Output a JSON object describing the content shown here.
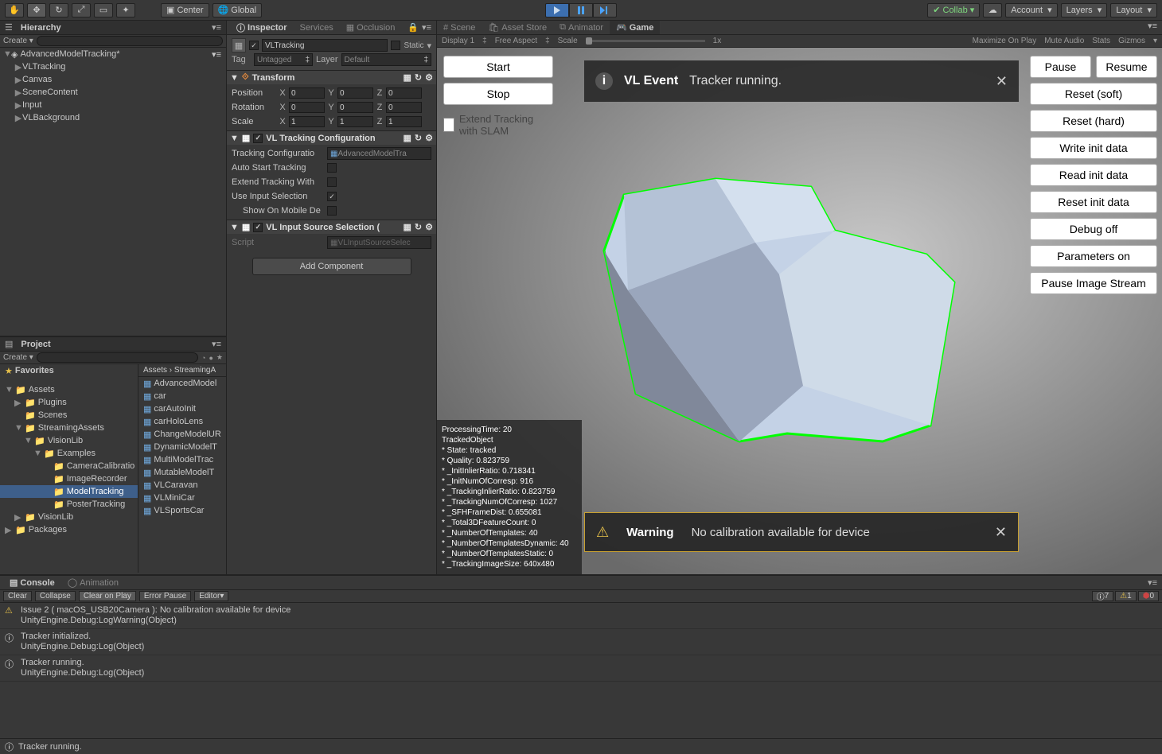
{
  "toolbar": {
    "pivot": "Center",
    "handle": "Global",
    "collab": "Collab",
    "account": "Account",
    "layers": "Layers",
    "layout": "Layout"
  },
  "hierarchy": {
    "title": "Hierarchy",
    "create": "Create",
    "scene": "AdvancedModelTracking*",
    "items": [
      "VLTracking",
      "Canvas",
      "SceneContent",
      "Input",
      "VLBackground"
    ]
  },
  "project": {
    "title": "Project",
    "create": "Create",
    "favorites": "Favorites",
    "tree": [
      {
        "label": "Assets",
        "depth": 0,
        "arrow": "▼"
      },
      {
        "label": "Plugins",
        "depth": 1,
        "arrow": "▶"
      },
      {
        "label": "Scenes",
        "depth": 1,
        "arrow": ""
      },
      {
        "label": "StreamingAssets",
        "depth": 1,
        "arrow": "▼"
      },
      {
        "label": "VisionLib",
        "depth": 2,
        "arrow": "▼"
      },
      {
        "label": "Examples",
        "depth": 3,
        "arrow": "▼"
      },
      {
        "label": "CameraCalibratio",
        "depth": 4,
        "arrow": ""
      },
      {
        "label": "ImageRecorder",
        "depth": 4,
        "arrow": ""
      },
      {
        "label": "ModelTracking",
        "depth": 4,
        "arrow": "",
        "sel": true
      },
      {
        "label": "PosterTracking",
        "depth": 4,
        "arrow": ""
      },
      {
        "label": "VisionLib",
        "depth": 1,
        "arrow": "▶"
      },
      {
        "label": "Packages",
        "depth": 0,
        "arrow": "▶"
      }
    ],
    "breadcrumb": [
      "Assets",
      "StreamingA"
    ],
    "files": [
      "AdvancedModel",
      "car",
      "carAutoInit",
      "carHoloLens",
      "ChangeModelUR",
      "DynamicModelT",
      "MultiModelTrac",
      "MutableModelT",
      "VLCaravan",
      "VLMiniCar",
      "VLSportsCar"
    ]
  },
  "inspector": {
    "title": "Inspector",
    "tabs": [
      "Services",
      "Occlusion"
    ],
    "obj_name": "VLTracking",
    "static": "Static",
    "tag_lbl": "Tag",
    "tag": "Untagged",
    "layer_lbl": "Layer",
    "layer": "Default",
    "transform": {
      "title": "Transform",
      "position": {
        "label": "Position",
        "x": "0",
        "y": "0",
        "z": "0"
      },
      "rotation": {
        "label": "Rotation",
        "x": "0",
        "y": "0",
        "z": "0"
      },
      "scale": {
        "label": "Scale",
        "x": "1",
        "y": "1",
        "z": "1"
      }
    },
    "vltracking": {
      "title": "VL Tracking Configuration",
      "fields": {
        "cfg_lbl": "Tracking Configuratio",
        "cfg_val": "AdvancedModelTra",
        "auto_lbl": "Auto Start Tracking",
        "ext_lbl": "Extend Tracking With",
        "inp_lbl": "Use Input Selection",
        "mob_lbl": "Show On Mobile De"
      }
    },
    "vlinput": {
      "title": "VL Input Source Selection (",
      "script_lbl": "Script",
      "script_val": "VLInputSourceSelec"
    },
    "add_component": "Add Component"
  },
  "game": {
    "tabs": {
      "scene": "Scene",
      "asset_store": "Asset Store",
      "animator": "Animator",
      "game": "Game"
    },
    "opts": {
      "display": "Display 1",
      "aspect": "Free Aspect",
      "scale_lbl": "Scale",
      "scale_val": "1x",
      "max": "Maximize On Play",
      "mute": "Mute Audio",
      "stats": "Stats",
      "gizmos": "Gizmos"
    },
    "left_buttons": {
      "start": "Start",
      "stop": "Stop"
    },
    "extend_label": "Extend Tracking with SLAM",
    "event": {
      "title": "VL Event",
      "msg": "Tracker running."
    },
    "right_buttons": [
      "Pause",
      "Resume",
      "Reset (soft)",
      "Reset (hard)",
      "Write init data",
      "Read init data",
      "Reset init data",
      "Debug off",
      "Parameters on",
      "Pause Image Stream"
    ],
    "stats": [
      "ProcessingTime: 20",
      "TrackedObject",
      "* State: tracked",
      "* Quality: 0.823759",
      "* _InitInlierRatio: 0.718341",
      "* _InitNumOfCorresp: 916",
      "* _TrackingInlierRatio: 0.823759",
      "* _TrackingNumOfCorresp: 1027",
      "* _SFHFrameDist: 0.655081",
      "* _Total3DFeatureCount: 0",
      "* _NumberOfTemplates: 40",
      "* _NumberOfTemplatesDynamic: 40",
      "* _NumberOfTemplatesStatic: 0",
      "* _TrackingImageSize: 640x480"
    ],
    "warning": {
      "title": "Warning",
      "msg": "No calibration available for device"
    }
  },
  "console": {
    "title": "Console",
    "anim": "Animation",
    "bar": {
      "clear": "Clear",
      "collapse": "Collapse",
      "cop": "Clear on Play",
      "ep": "Error Pause",
      "editor": "Editor"
    },
    "counts": {
      "info": "7",
      "warn": "1",
      "err": "0"
    },
    "logs": [
      {
        "icon": "warn",
        "line1": "Issue 2 ( macOS_USB20Camera ): No calibration available for device",
        "line2": "UnityEngine.Debug:LogWarning(Object)"
      },
      {
        "icon": "info",
        "line1": "Tracker initialized.",
        "line2": "UnityEngine.Debug:Log(Object)"
      },
      {
        "icon": "info",
        "line1": "Tracker running.",
        "line2": "UnityEngine.Debug:Log(Object)"
      }
    ],
    "status": "Tracker running."
  }
}
